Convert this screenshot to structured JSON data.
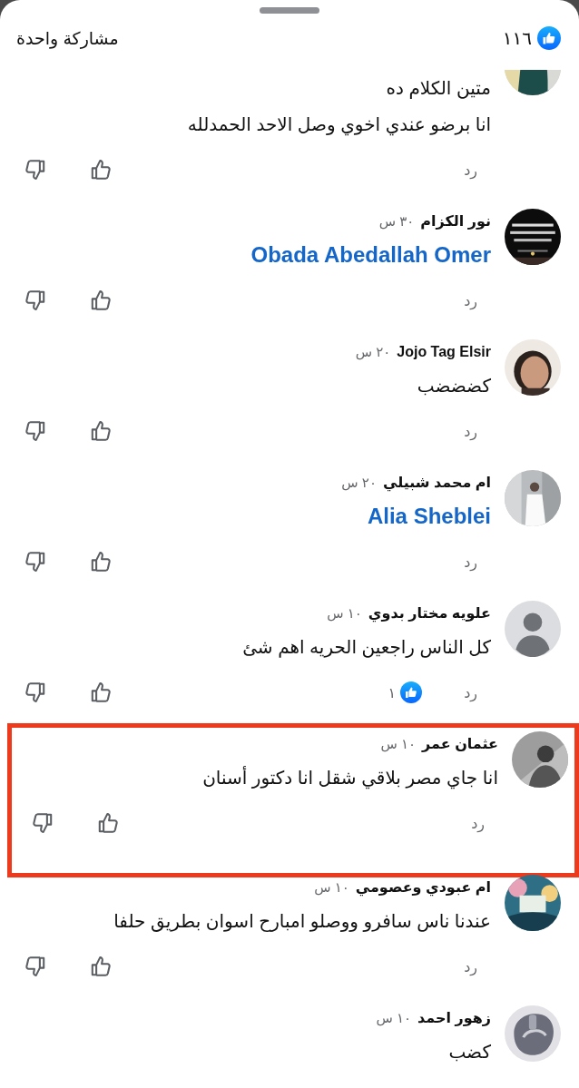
{
  "header": {
    "reaction_count": "١١٦",
    "shares": "مشاركة واحدة"
  },
  "comments": [
    {
      "avatar": {
        "kind": "picture"
      },
      "lines": [
        {
          "kind": "text",
          "text": "متين الكلام ده"
        },
        {
          "kind": "text",
          "text": "انا برضو عندي اخوي وصل الاحد الحمدلله"
        }
      ],
      "reply": "رد",
      "highlighted": false
    },
    {
      "name": "نور الكزام",
      "time": "٣٠ س",
      "avatar": {
        "kind": "picture"
      },
      "lines": [
        {
          "kind": "mention",
          "text": "Obada Abedallah Omer"
        }
      ],
      "reply": "رد",
      "highlighted": false
    },
    {
      "name": "Jojo Tag Elsir",
      "time": "٢٠ س",
      "avatar": {
        "kind": "picture"
      },
      "lines": [
        {
          "kind": "text",
          "text": "كضضضب"
        }
      ],
      "reply": "رد",
      "highlighted": false
    },
    {
      "name": "ام محمد شبيلي",
      "time": "٢٠ س",
      "avatar": {
        "kind": "picture"
      },
      "lines": [
        {
          "kind": "mention",
          "text": "Alia Sheblei"
        }
      ],
      "reply": "رد",
      "highlighted": false
    },
    {
      "name": "علويه مختار بدوي",
      "time": "١٠ س",
      "avatar": {
        "kind": "default"
      },
      "lines": [
        {
          "kind": "text",
          "text": "كل الناس راجعين الحريه اهم شئ"
        }
      ],
      "reply": "رد",
      "reaction_count": "١",
      "highlighted": false
    },
    {
      "name": "عثمان عمر",
      "time": "١٠ س",
      "avatar": {
        "kind": "picture"
      },
      "lines": [
        {
          "kind": "text",
          "text": "انا جاي مصر بلاقي شقل انا دكتور أسنان"
        }
      ],
      "reply": "رد",
      "highlighted": true
    },
    {
      "name": "ام عبودي وعصومي",
      "time": "١٠ س",
      "avatar": {
        "kind": "picture"
      },
      "lines": [
        {
          "kind": "text",
          "text": "عندنا ناس سافرو ووصلو امبارح اسوان بطريق حلفا"
        }
      ],
      "reply": "رد",
      "highlighted": false
    },
    {
      "name": "زهور احمد",
      "time": "١٠ س",
      "avatar": {
        "kind": "picture"
      },
      "lines": [
        {
          "kind": "text",
          "text": "كضب"
        }
      ],
      "highlighted": false
    }
  ]
}
